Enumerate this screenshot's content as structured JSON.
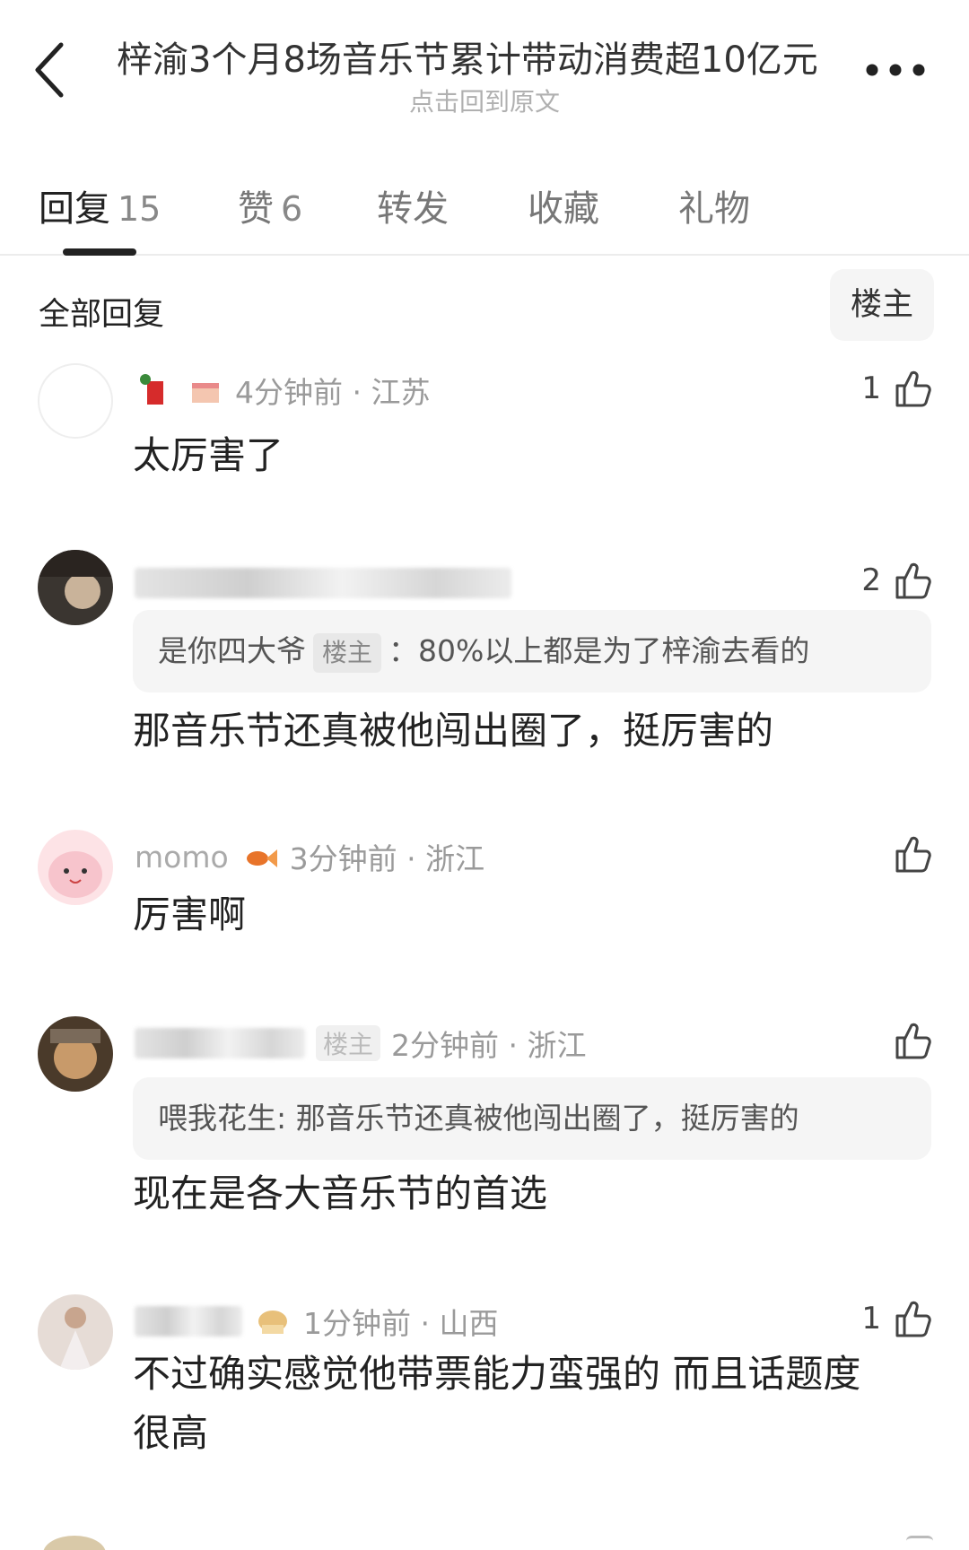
{
  "header": {
    "title": "梓渝3个月8场音乐节累计带动消费超10亿元",
    "subtitle": "点击回到原文",
    "back_icon": "chevron-left-icon",
    "more_icon": "more-dots-icon"
  },
  "tabs": [
    {
      "label": "回复",
      "count": "15",
      "active": true
    },
    {
      "label": "赞",
      "count": "6",
      "active": false
    },
    {
      "label": "转发",
      "count": "",
      "active": false
    },
    {
      "label": "收藏",
      "count": "",
      "active": false
    },
    {
      "label": "礼物",
      "count": "",
      "active": false
    }
  ],
  "filter": {
    "label": "全部回复",
    "op_button": "楼主"
  },
  "comments": [
    {
      "time_location": "4分钟前 · 江苏",
      "likes": "1",
      "body": "太厉害了"
    },
    {
      "time_location": "",
      "likes": "2",
      "quote_user": "是你四大爷",
      "quote_tag": "楼主",
      "quote_text": "：80%以上都是为了梓渝去看的",
      "body": "那音乐节还真被他闯出圈了，挺厉害的"
    },
    {
      "name": "momo",
      "time_location": "3分钟前 · 浙江",
      "likes": "",
      "body": "厉害啊"
    },
    {
      "name_tag": "楼主",
      "time_location": "2分钟前 · 浙江",
      "likes": "",
      "quote_user": "喂我花生",
      "quote_text": ": 那音乐节还真被他闯出圈了，挺厉害的",
      "body": "现在是各大音乐节的首选"
    },
    {
      "time_location": "1分钟前 · 山西",
      "likes": "1",
      "body_line1": "不过确实感觉他带票能力蛮强的  而且话题度",
      "body_line2": "很高"
    }
  ],
  "colors": {
    "text": "#222222",
    "muted": "#9a9a9a",
    "quote_bg": "#f5f5f5",
    "divider": "#ececec"
  }
}
